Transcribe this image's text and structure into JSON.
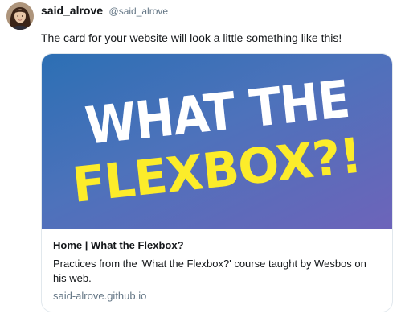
{
  "tweet": {
    "display_name": "said_alrove",
    "handle": "@said_alrove",
    "text": "The card for your website will look a little something like this!"
  },
  "card": {
    "image_line1": "WHAT THE",
    "image_line2": "FLEXBOX?!",
    "title": "Home | What the Flexbox?",
    "description": "Practices from the 'What the Flexbox?' course taught by Wesbos on his web.",
    "domain": "said-alrove.github.io"
  },
  "colors": {
    "name_text": "#14171a",
    "secondary_text": "#657786",
    "card_border": "#e1e8ed",
    "image_gradient_start": "#2c6fb4",
    "image_gradient_end": "#6d64ba",
    "headline_white": "#ffffff",
    "headline_yellow": "#fcec2a"
  },
  "icons": {
    "avatar": "profile-photo"
  }
}
